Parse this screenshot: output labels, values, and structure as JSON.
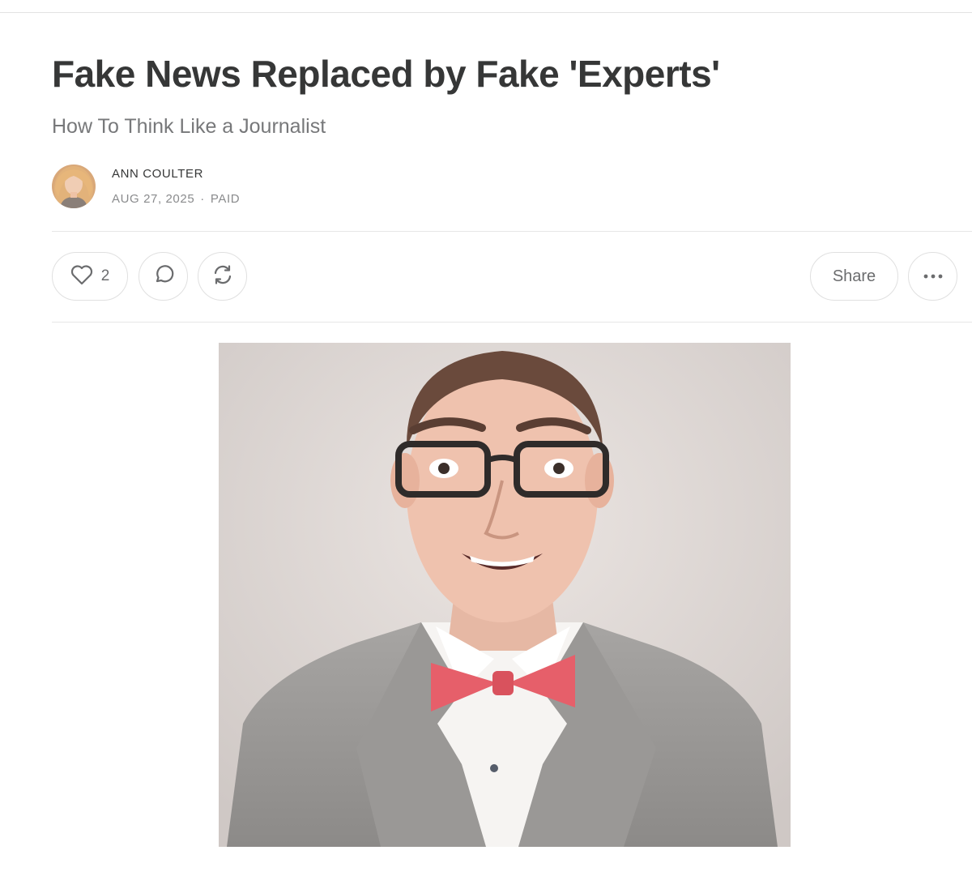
{
  "post": {
    "title": "Fake News Replaced by Fake 'Experts'",
    "subtitle": "How To Think Like a Journalist",
    "author": "ANN COULTER",
    "date": "AUG 27, 2025",
    "separator": "·",
    "access": "PAID"
  },
  "actions": {
    "like_count": "2",
    "share_label": "Share",
    "icons": {
      "like": "heart-icon",
      "comment": "comment-bubble-icon",
      "restack": "restack-icon",
      "more": "more-dots-icon"
    }
  },
  "colors": {
    "title": "#363737",
    "subtitle": "#77787a",
    "meta": "#8a8b8d",
    "border": "#e0e0e0"
  }
}
